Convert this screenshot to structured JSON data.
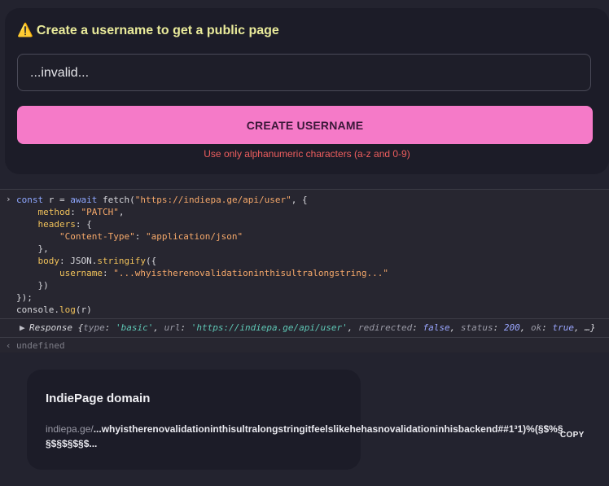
{
  "form": {
    "warning_icon": "⚠️",
    "title": "Create a username to get a public page",
    "input_value": "...invalid...",
    "create_button_label": "CREATE USERNAME",
    "hint": "Use only alphanumeric characters (a-z and 0-9)"
  },
  "console": {
    "input_prompt": "›",
    "code": {
      "l1_kw": "const",
      "l1_var": " r = ",
      "l1_await": "await",
      "l1_fetch": " fetch(",
      "l1_url": "\"https://indiepa.ge/api/user\"",
      "l1_end": ", {",
      "l2_key": "method",
      "l2_val": "\"PATCH\"",
      "l3_key": "headers",
      "l4_key": "\"Content-Type\"",
      "l4_val": "\"application/json\"",
      "l5": "},",
      "l6_key": "body",
      "l6_fn": "JSON.",
      "l6_method": "stringify",
      "l7_key": "username",
      "l7_val": "\"...whyistherenovalidationinthisultralongstring...\"",
      "l8": "})",
      "l9": "});",
      "l10_obj": "console.",
      "l10_fn": "log",
      "l10_arg": "(r)"
    },
    "response": {
      "expand_icon": "▶",
      "label": "Response",
      "type_key": "type",
      "type_val": "'basic'",
      "url_key": "url",
      "url_val": "'https://indiepa.ge/api/user'",
      "redirected_key": "redirected",
      "redirected_val": "false",
      "status_key": "status",
      "status_val": "200",
      "ok_key": "ok",
      "ok_val": "true",
      "ellipsis": "…}"
    },
    "result_prompt": "‹",
    "result": "undefined"
  },
  "domain": {
    "title": "IndiePage domain",
    "base": "indiepa.ge/",
    "value": "...whyistherenovalidationinthisultralongstringitfeelslikehehasnovalidationinhisbackend##1³1)%(§$%§§$§$§$§$...",
    "copy_label": "COPY"
  }
}
